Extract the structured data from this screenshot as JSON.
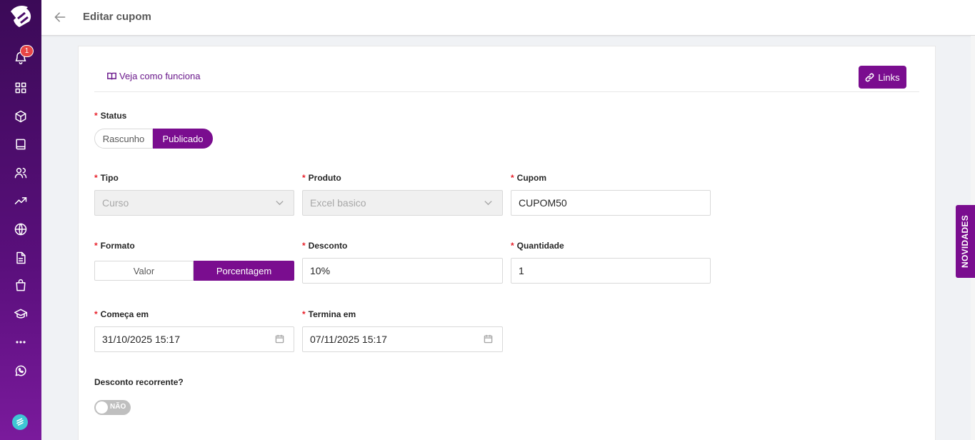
{
  "header": {
    "title": "Editar cupom"
  },
  "sidebar": {
    "notification_count": "1",
    "items": [
      "bell-icon",
      "grid-icon",
      "box-icon",
      "book-icon",
      "users-icon",
      "trend-icon",
      "globe-icon",
      "file-icon",
      "bag-icon",
      "graduation-icon",
      "more-icon",
      "whatsapp-icon"
    ]
  },
  "toolbar": {
    "how_it_works": "Veja como funciona",
    "links_label": "Links"
  },
  "form": {
    "status": {
      "label": "Status",
      "options": [
        "Rascunho",
        "Publicado"
      ],
      "selected": "Publicado"
    },
    "tipo": {
      "label": "Tipo",
      "value": "Curso"
    },
    "produto": {
      "label": "Produto",
      "value": "Excel basico"
    },
    "cupom": {
      "label": "Cupom",
      "value": "CUPOM50"
    },
    "formato": {
      "label": "Formato",
      "options": [
        "Valor",
        "Porcentagem"
      ],
      "selected": "Porcentagem"
    },
    "desconto": {
      "label": "Desconto",
      "value": "10%"
    },
    "quantidade": {
      "label": "Quantidade",
      "value": "1"
    },
    "comeca": {
      "label": "Começa em",
      "value": "31/10/2025 15:17"
    },
    "termina": {
      "label": "Termina em",
      "value": "07/11/2025 15:17"
    },
    "recorrente": {
      "label": "Desconto recorrente?",
      "toggle_text": "NÃO",
      "value": false
    }
  },
  "side_tab": {
    "label": "NOVIDADES"
  },
  "colors": {
    "brand": "#7a0d8f",
    "required": "#e8202a"
  }
}
